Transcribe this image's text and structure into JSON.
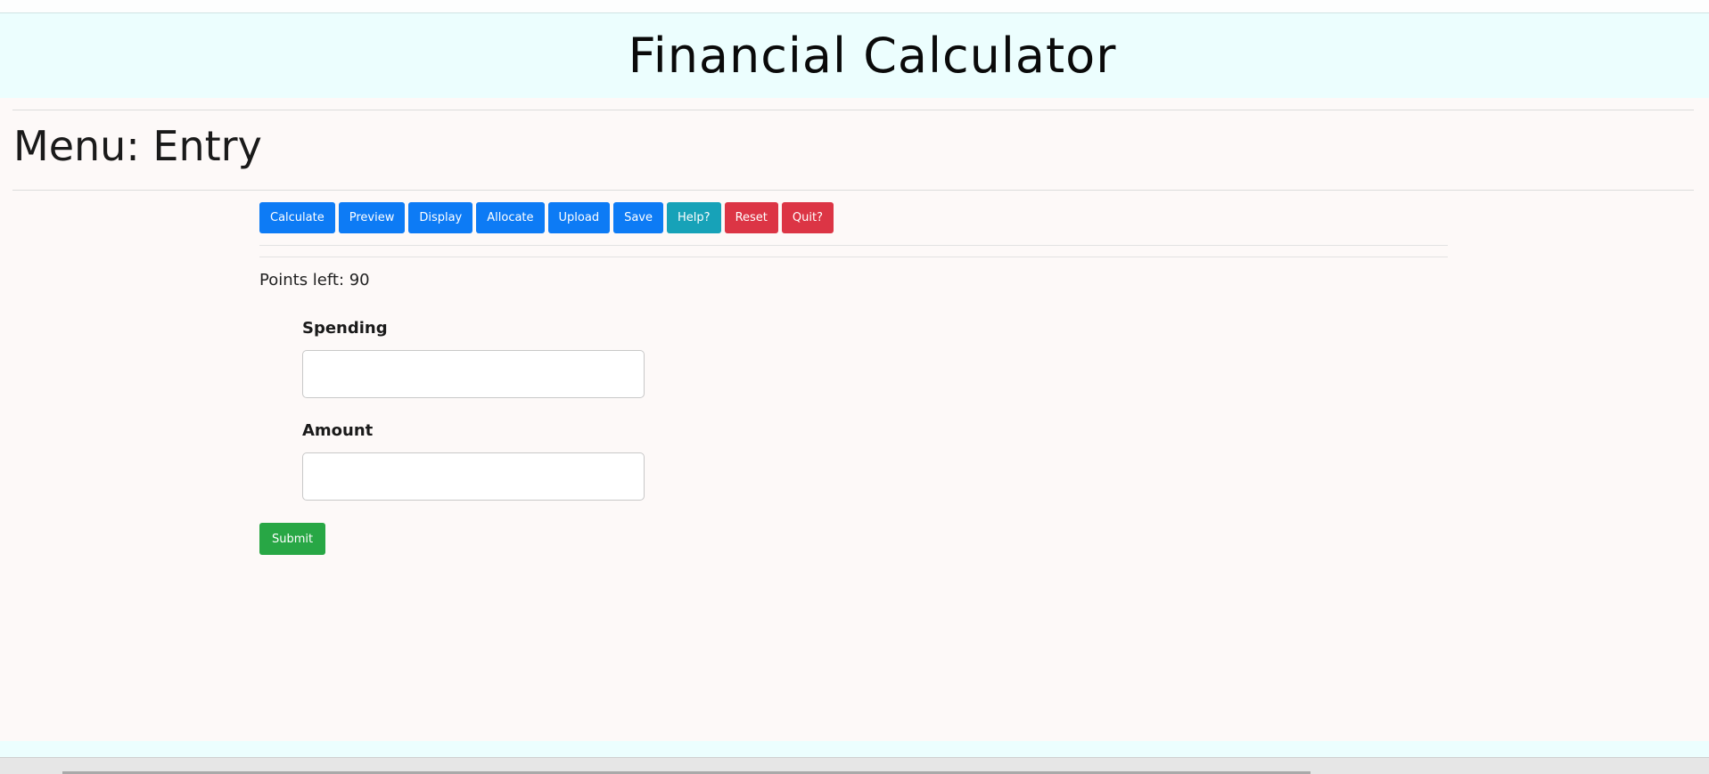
{
  "header": {
    "title": "Financial Calculator"
  },
  "menu": {
    "heading": "Menu: Entry"
  },
  "toolbar": {
    "buttons": [
      {
        "label": "Calculate",
        "style": "primary"
      },
      {
        "label": "Preview",
        "style": "primary"
      },
      {
        "label": "Display",
        "style": "primary"
      },
      {
        "label": "Allocate",
        "style": "primary"
      },
      {
        "label": "Upload",
        "style": "primary"
      },
      {
        "label": "Save",
        "style": "primary"
      },
      {
        "label": "Help?",
        "style": "info"
      },
      {
        "label": "Reset",
        "style": "danger"
      },
      {
        "label": "Quit?",
        "style": "danger"
      }
    ]
  },
  "form": {
    "points_left": "Points left: 90",
    "spending_label": "Spending",
    "spending_value": "",
    "amount_label": "Amount",
    "amount_value": "",
    "submit_label": "Submit"
  },
  "colors": {
    "primary": "#0d7bf5",
    "info": "#17a2b8",
    "danger": "#dc3545",
    "success": "#28a745",
    "header_bg": "#ecfefe",
    "page_bg": "#fdf9f8"
  }
}
